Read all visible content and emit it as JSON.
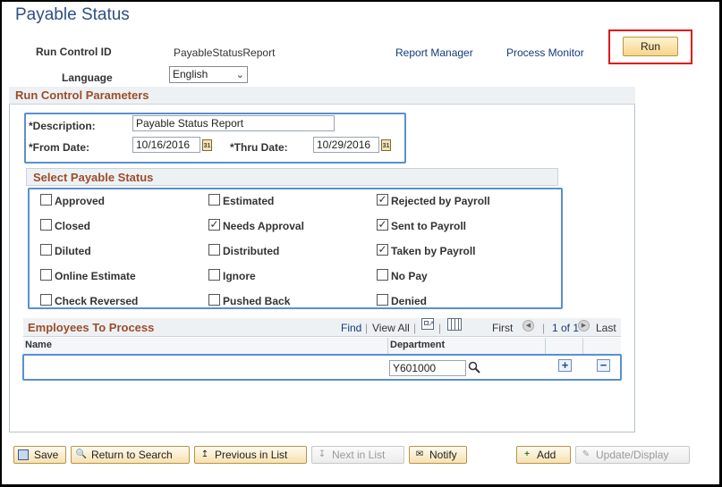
{
  "page_title": "Payable Status",
  "header": {
    "run_control_label": "Run Control ID",
    "run_control_value": "PayableStatusReport",
    "report_manager": "Report Manager",
    "process_monitor": "Process Monitor",
    "run_label": "Run",
    "language_label": "Language",
    "language_value": "English"
  },
  "params": {
    "title": "Run Control Parameters",
    "description_label": "*Description:",
    "description_value": "Payable Status Report",
    "from_date_label": "*From Date:",
    "from_date_value": "10/16/2016",
    "thru_date_label": "*Thru Date:",
    "thru_date_value": "10/29/2016",
    "calendar_glyph": "31"
  },
  "status": {
    "title": "Select Payable Status",
    "items": [
      {
        "label": "Approved",
        "checked": false
      },
      {
        "label": "Estimated",
        "checked": false
      },
      {
        "label": "Rejected by Payroll",
        "checked": true
      },
      {
        "label": "Closed",
        "checked": false
      },
      {
        "label": "Needs Approval",
        "checked": true
      },
      {
        "label": "Sent to Payroll",
        "checked": true
      },
      {
        "label": "Diluted",
        "checked": false
      },
      {
        "label": "Distributed",
        "checked": false
      },
      {
        "label": "Taken by Payroll",
        "checked": true
      },
      {
        "label": "Online Estimate",
        "checked": false
      },
      {
        "label": "Ignore",
        "checked": false
      },
      {
        "label": "No Pay",
        "checked": false
      },
      {
        "label": "Check Reversed",
        "checked": false
      },
      {
        "label": "Pushed Back",
        "checked": false
      },
      {
        "label": "Denied",
        "checked": false
      }
    ]
  },
  "employees": {
    "title": "Employees To Process",
    "find": "Find",
    "view_all": "View All",
    "first": "First",
    "pager": "1 of 1",
    "last": "Last",
    "col_name": "Name",
    "col_department": "Department",
    "department_value": "Y601000"
  },
  "toolbar": {
    "save": "Save",
    "return_to_search": "Return to Search",
    "previous_in_list": "Previous in List",
    "next_in_list": "Next in List",
    "notify": "Notify",
    "add": "Add",
    "update_display": "Update/Display"
  },
  "colors": {
    "title_blue": "#2e4f84",
    "section_brown": "#9b4d2a",
    "highlight_blue": "#5b8fcf",
    "highlight_red": "#e0151c"
  }
}
